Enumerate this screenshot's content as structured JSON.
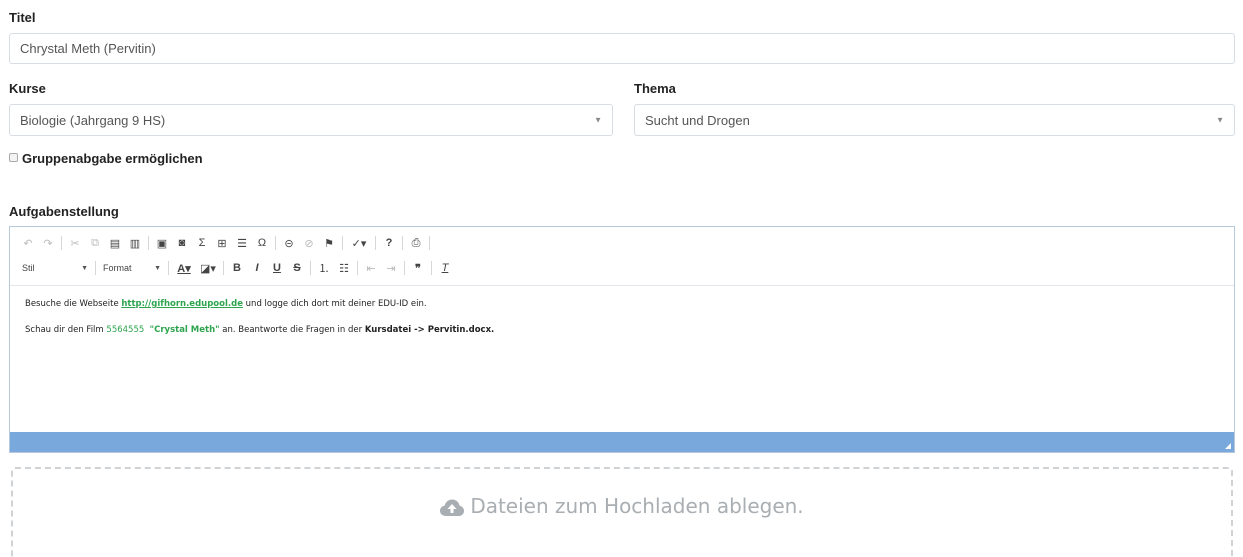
{
  "title_field": {
    "label": "Titel",
    "value": "Chrystal Meth (Pervitin)"
  },
  "kurse_field": {
    "label": "Kurse",
    "value": "Biologie (Jahrgang 9 HS)"
  },
  "thema_field": {
    "label": "Thema",
    "value": "Sucht und Drogen"
  },
  "group_option": {
    "label": "Gruppenabgabe ermöglichen",
    "checked": false
  },
  "editor": {
    "label": "Aufgabenstellung",
    "toolbar": {
      "style_combo": "Stil",
      "format_combo": "Format"
    },
    "content": {
      "line1_pre": "Besuche die Webseite ",
      "line1_link": "http://gifhorn.edupool.de",
      "line1_post": " und logge dich dort mit deiner EDU-ID ein.",
      "line2_pre": "Schau dir den Film ",
      "line2_num": "5564555",
      "line2_title": "\"Crystal Meth\"",
      "line2_mid": " an. Beantworte die Fragen in der ",
      "line2_bold": "Kursdatei -> Pervitin.docx."
    },
    "statusbar_color": "#79a9dc"
  },
  "dropzone": {
    "text": "Dateien zum Hochladen ablegen.",
    "icon": "cloud-upload-icon"
  }
}
